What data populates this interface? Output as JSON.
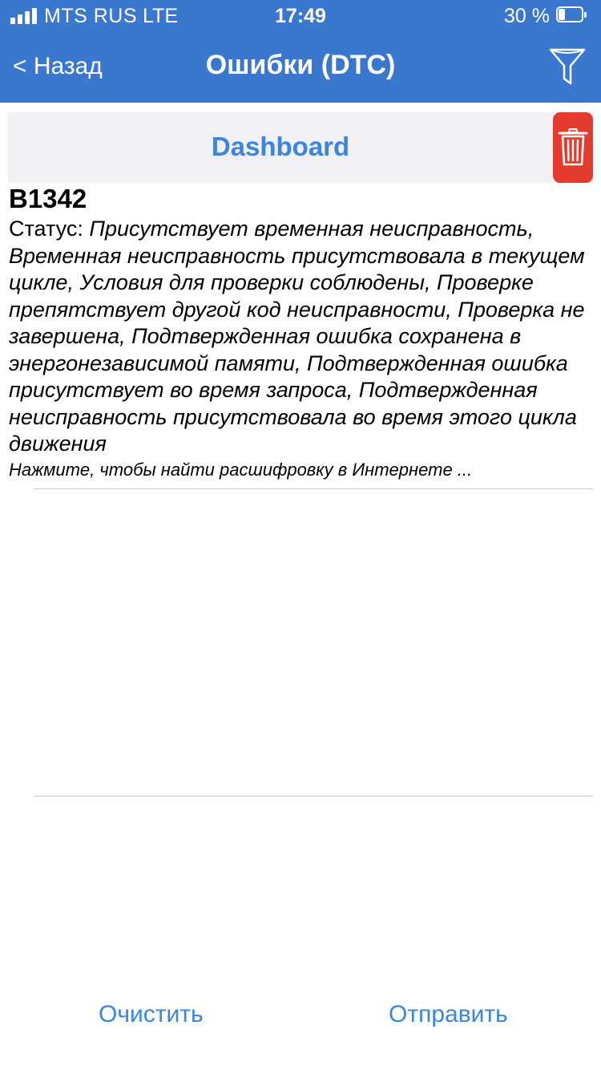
{
  "status_bar": {
    "carrier": "MTS RUS",
    "network": "LTE",
    "time": "17:49",
    "battery_percent_text": "30 %",
    "battery_level": 0.3
  },
  "nav": {
    "back_label": "< Назад",
    "title": "Ошибки (DTC)",
    "filter_icon": "filter-icon"
  },
  "dashboard": {
    "label": "Dashboard",
    "delete_icon": "trash-icon"
  },
  "dtc_list": [
    {
      "code": "B1342",
      "status_label": "Статус:",
      "status_text": "Присутствует временная неисправность, Временная неисправность присутствовала в текущем цикле, Условия для проверки соблюдены, Проверке препятствует другой код неисправности, Проверка не завершена, Подтвержденная ошибка сохранена в энергонезависимой памяти, Подтвержденная ошибка присутствует во время запроса, Подтвержденная неисправность присутствовала во время этого цикла движения",
      "hint": "Нажмите, чтобы найти расшифровку в Интернете ..."
    }
  ],
  "toolbar": {
    "clear_label": "Очистить",
    "send_label": "Отправить"
  },
  "colors": {
    "header": "#3a78d0",
    "accent": "#3a85e0",
    "delete": "#e53a2e",
    "dashboard_bg": "#f1f0f5"
  }
}
